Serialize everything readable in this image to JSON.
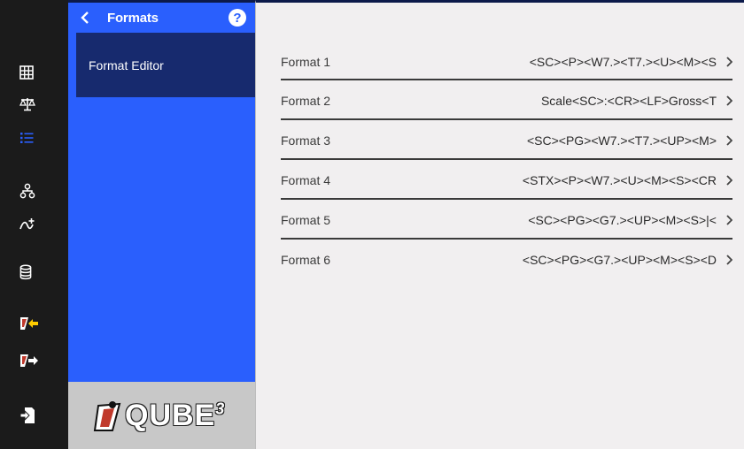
{
  "panel": {
    "title": "Formats",
    "help_label": "?",
    "menu_item": "Format Editor"
  },
  "logo": {
    "text": "QUBE",
    "superscript": "3"
  },
  "rail_icons": [
    "grid-icon",
    "scale-icon",
    "list-icon",
    "hierarchy-icon",
    "workflow-icon",
    "database-icon",
    "import-icon",
    "export-icon",
    "logout-icon"
  ],
  "formats": [
    {
      "label": "Format 1",
      "value": "<SC><P><W7.><T7.><U><M><S"
    },
    {
      "label": "Format 2",
      "value": "Scale<SC>:<CR><LF>Gross<T"
    },
    {
      "label": "Format 3",
      "value": "<SC><PG><W7.><T7.><UP><M>"
    },
    {
      "label": "Format 4",
      "value": "<STX><P><W7.><U><M><S><CR"
    },
    {
      "label": "Format 5",
      "value": "<SC><PG><G7.><UP><M><S>|<"
    },
    {
      "label": "Format 6",
      "value": "<SC><PG><G7.><UP><M><S><D"
    }
  ],
  "colors": {
    "rail": "#1b1b1b",
    "panel": "#2a5ffd",
    "active_menu": "#172a6e",
    "main_bg": "#f1eff0",
    "active_rail_icon": "#2a5ffd"
  }
}
